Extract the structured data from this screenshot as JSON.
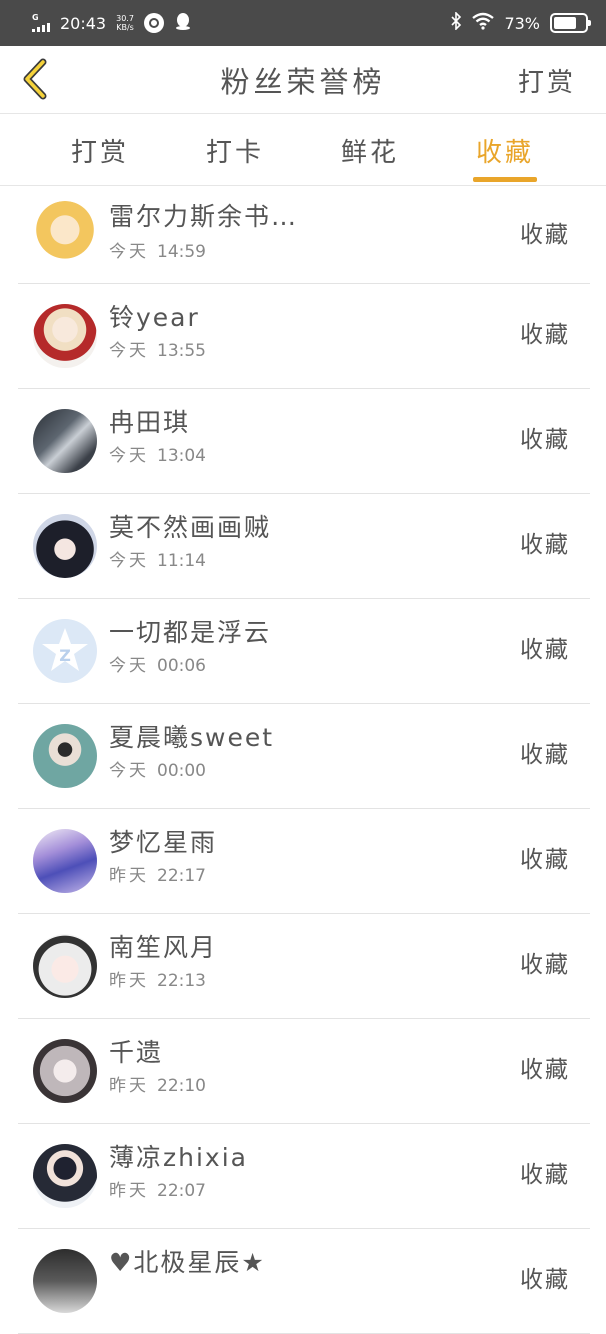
{
  "status_bar": {
    "network": "G",
    "time": "20:43",
    "speed_value": "30.7",
    "speed_unit": "KB/s",
    "battery_percent": "73%",
    "battery_level": 0.73
  },
  "header": {
    "title": "粉丝荣誉榜",
    "action_label": "打赏"
  },
  "tabs": [
    {
      "label": "打赏",
      "active": false
    },
    {
      "label": "打卡",
      "active": false
    },
    {
      "label": "鲜花",
      "active": false
    },
    {
      "label": "收藏",
      "active": true
    }
  ],
  "colors": {
    "accent": "#e9a52a",
    "status_bar_bg": "#4a4a4a",
    "text": "#555555",
    "subtext": "#888888"
  },
  "fans": [
    {
      "name": "雷尔力斯余书…",
      "day": "今天",
      "time": "14:59",
      "action": "收藏"
    },
    {
      "name": "铃year",
      "day": "今天",
      "time": "13:55",
      "action": "收藏"
    },
    {
      "name": "冉田琪",
      "day": "今天",
      "time": "13:04",
      "action": "收藏"
    },
    {
      "name": "莫不然画画贼",
      "day": "今天",
      "time": "11:14",
      "action": "收藏"
    },
    {
      "name": "一切都是浮云",
      "day": "今天",
      "time": "00:06",
      "action": "收藏"
    },
    {
      "name": "夏晨曦sweet",
      "day": "今天",
      "time": "00:00",
      "action": "收藏"
    },
    {
      "name": "梦忆星雨",
      "day": "昨天",
      "time": "22:17",
      "action": "收藏"
    },
    {
      "name": "南笙风月",
      "day": "昨天",
      "time": "22:13",
      "action": "收藏"
    },
    {
      "name": "千遗",
      "day": "昨天",
      "time": "22:10",
      "action": "收藏"
    },
    {
      "name": "薄凉zhixia",
      "day": "昨天",
      "time": "22:07",
      "action": "收藏"
    },
    {
      "name": "♥北极星辰★",
      "day": "",
      "time": "",
      "action": "收藏"
    }
  ]
}
